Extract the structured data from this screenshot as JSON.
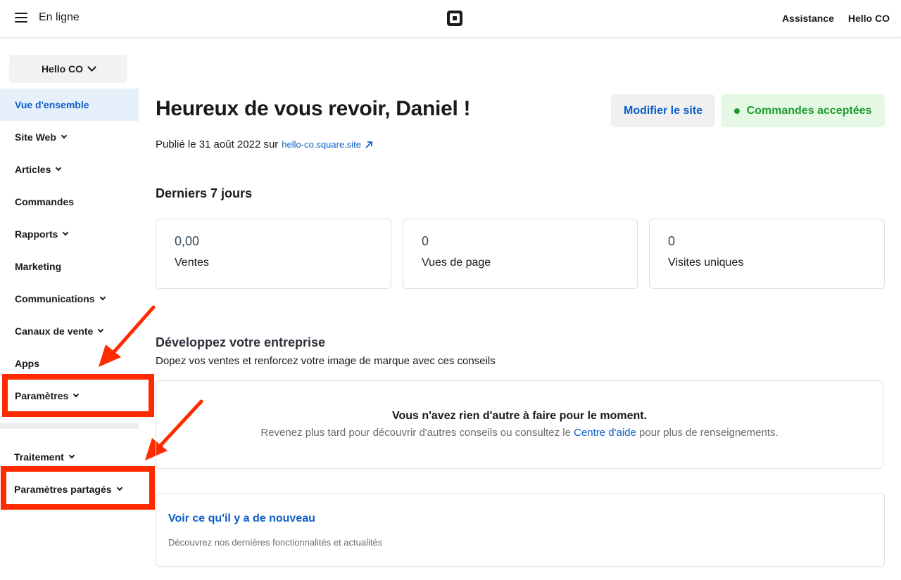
{
  "topbar": {
    "title": "En ligne",
    "help": "Assistance",
    "account": "Hello CO"
  },
  "sidebar": {
    "account_select": "Hello CO",
    "items": [
      {
        "label": "Vue d'ensemble",
        "active": true,
        "has_chevron": false
      },
      {
        "label": "Site Web",
        "has_chevron": true
      },
      {
        "label": "Articles",
        "has_chevron": true
      },
      {
        "label": "Commandes",
        "has_chevron": false
      },
      {
        "label": "Rapports",
        "has_chevron": true
      },
      {
        "label": "Marketing",
        "has_chevron": false
      },
      {
        "label": "Communications",
        "has_chevron": true
      },
      {
        "label": "Canaux de vente",
        "has_chevron": true
      },
      {
        "label": "Apps",
        "has_chevron": false
      },
      {
        "label": "Paramètres",
        "has_chevron": true
      }
    ],
    "items2": [
      {
        "label": "Traitement",
        "has_chevron": true
      },
      {
        "label": "Paramètres partagés",
        "has_chevron": true
      }
    ]
  },
  "main": {
    "title": "Heureux de vous revoir, Daniel !",
    "edit_button": "Modifier le site",
    "orders_status": "Commandes acceptées",
    "published_text": "Publié le 31 août 2022 sur",
    "site_link": "hello-co.square.site",
    "stats_title": "Derniers 7 jours",
    "stats": [
      {
        "value": "0,00",
        "label": "Ventes"
      },
      {
        "value": "0",
        "label": "Vues de page"
      },
      {
        "value": "0",
        "label": "Visites uniques"
      }
    ],
    "grow_title": "Développez votre entreprise",
    "grow_subtitle": "Dopez vos ventes et renforcez votre image de marque avec ces conseils",
    "empty_title": "Vous n'avez rien d'autre à faire pour le moment.",
    "empty_sub_before": "Revenez plus tard pour découvrir d'autres conseils ou consultez le",
    "empty_link": "Centre d'aide",
    "empty_sub_after": "pour plus de renseignements.",
    "news_title": "Voir ce qu'il y a de nouveau",
    "news_sub": "Découvrez nos dernières fonctionnalités et actualités"
  },
  "colors": {
    "accent": "#0b5fc7",
    "success": "#1f9a2e",
    "annotation": "#ff2a00"
  }
}
